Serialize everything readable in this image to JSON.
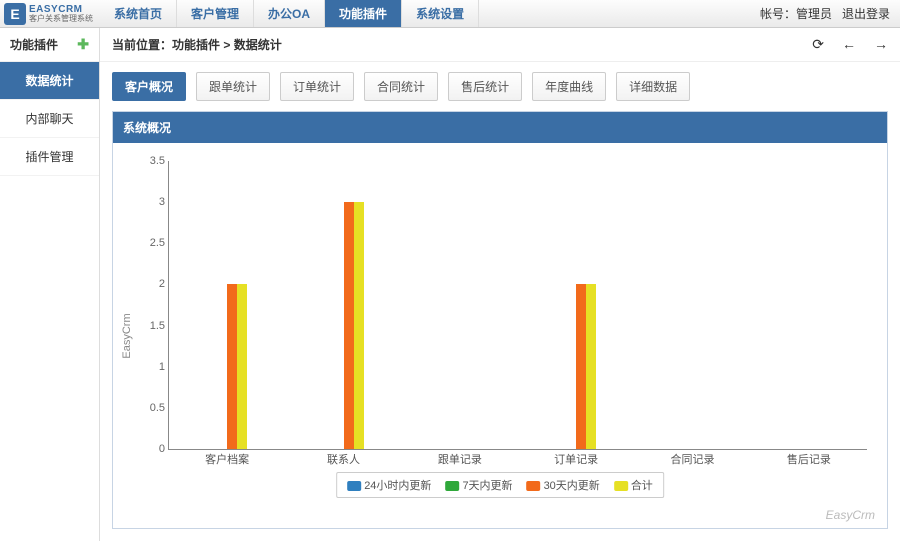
{
  "brand": {
    "mark": "E",
    "name": "EASYCRM",
    "sub": "客户关系管理系统"
  },
  "topnav": [
    "系统首页",
    "客户管理",
    "办公OA",
    "功能插件",
    "系统设置"
  ],
  "topnav_active": 3,
  "account_label": "帐号：",
  "account_user": "管理员",
  "logout": "退出登录",
  "sidebar": {
    "title": "功能插件",
    "items": [
      "数据统计",
      "内部聊天",
      "插件管理"
    ],
    "active": 0
  },
  "breadcrumb": {
    "prefix": "当前位置：",
    "path": "功能插件 > 数据统计"
  },
  "tabs": [
    "客户概况",
    "跟单统计",
    "订单统计",
    "合同统计",
    "售后统计",
    "年度曲线",
    "详细数据"
  ],
  "tabs_active": 0,
  "panel_title": "系统概况",
  "credit": "EasyCrm",
  "chart_data": {
    "type": "bar",
    "ylabel": "EasyCrm",
    "ylim": [
      0,
      3.5
    ],
    "yticks": [
      0,
      0.5,
      1,
      1.5,
      2,
      2.5,
      3,
      3.5
    ],
    "categories": [
      "客户档案",
      "联系人",
      "跟单记录",
      "订单记录",
      "合同记录",
      "售后记录"
    ],
    "series": [
      {
        "name": "24小时内更新",
        "color": "#2f7fbf",
        "values": [
          0,
          0,
          0,
          0,
          0,
          0
        ]
      },
      {
        "name": "7天内更新",
        "color": "#2fa83a",
        "values": [
          0,
          0,
          0,
          0,
          0,
          0
        ]
      },
      {
        "name": "30天内更新",
        "color": "#f26a1b",
        "values": [
          2,
          3,
          0,
          2,
          0,
          0
        ]
      },
      {
        "name": "合计",
        "color": "#e6e024",
        "values": [
          2,
          3,
          0,
          2,
          0,
          0
        ]
      }
    ]
  }
}
